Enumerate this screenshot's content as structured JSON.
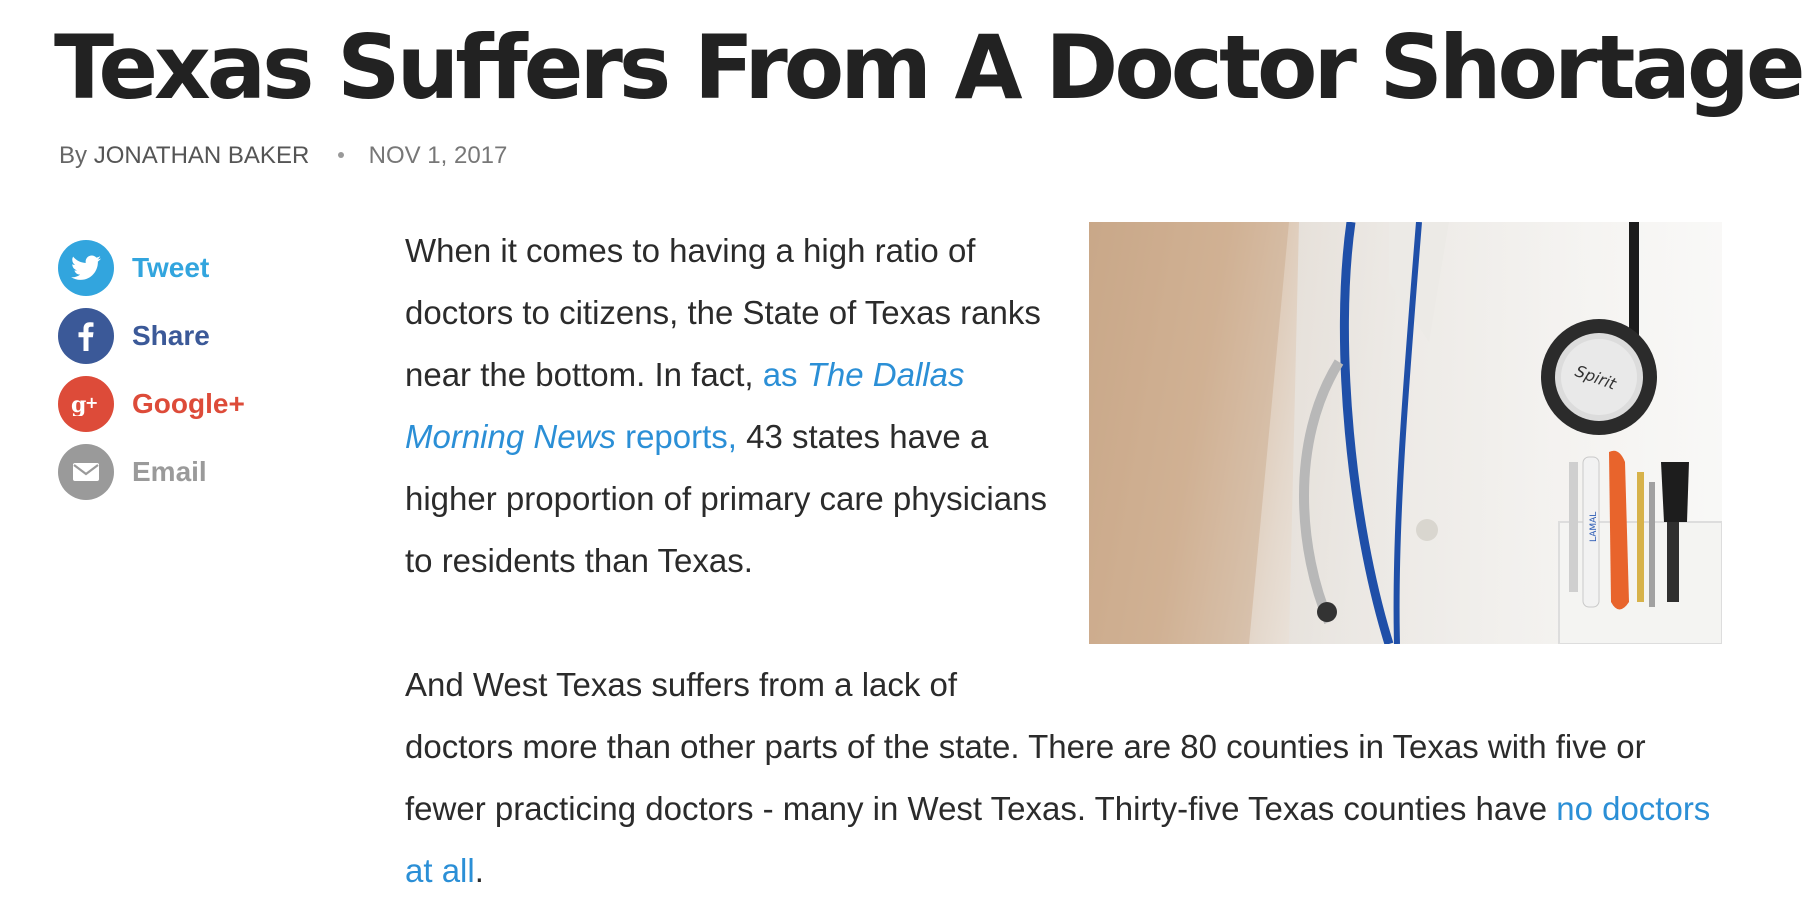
{
  "headline": "Texas Suffers From A Doctor Shortage",
  "byline": {
    "by": "By",
    "author": "JONATHAN BAKER",
    "date": "NOV 1, 2017"
  },
  "share": [
    {
      "label": "Tweet",
      "icon": "twitter-icon",
      "color": "#32a5de"
    },
    {
      "label": "Share",
      "icon": "facebook-icon",
      "color": "#3b5998"
    },
    {
      "label": "Google+",
      "icon": "google-plus-icon",
      "color": "#dd4b39"
    },
    {
      "label": "Email",
      "icon": "email-icon",
      "color": "#9a9a9a"
    }
  ],
  "article": {
    "p1_a": "When it comes to having a high ratio of doctors to citizens, the State of Texas ranks near the bottom. In fact, ",
    "p1_link_pre": "as ",
    "p1_link_em": "The Dallas Morning News",
    "p1_link_post": " reports,",
    "p1_b": " 43 states have a higher proportion of primary care physicians to residents than Texas.",
    "p2_a": "And West Texas suffers from a lack of doctors more than other parts of the state. There are 80 counties in Texas with five or fewer practicing doctors - many in West Texas. Thirty-five Texas counties have ",
    "p2_link": "no doctors at all",
    "p2_b": "."
  },
  "photo": {
    "stethoscope_text": "Spirit",
    "pen_text": "LAMAL"
  },
  "colors": {
    "link": "#2b8fd6",
    "headline": "#222222"
  }
}
